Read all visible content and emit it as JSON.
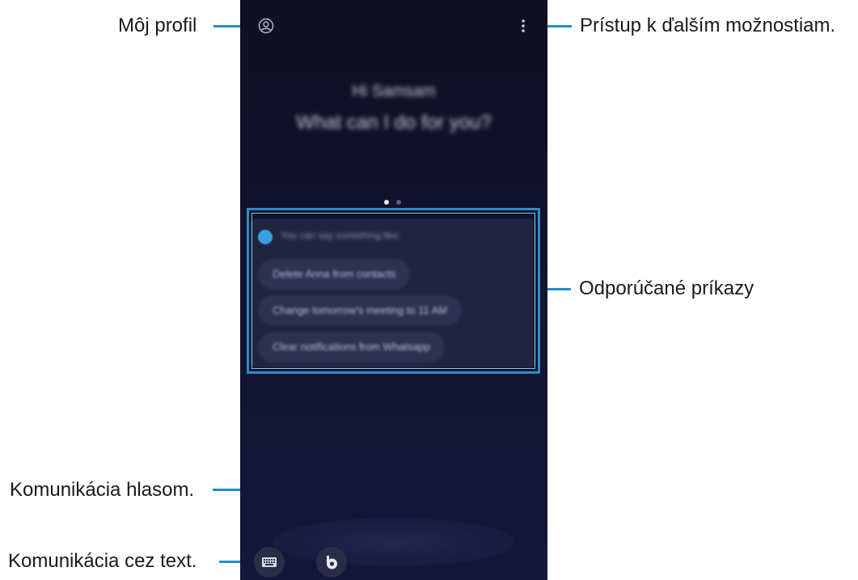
{
  "callouts": {
    "my_profile": "Môj profil",
    "more_options": "Prístup k ďalším možnostiam.",
    "suggested_commands": "Odporúčané príkazy",
    "voice": "Komunikácia hlasom.",
    "text": "Komunikácia cez text."
  },
  "screen": {
    "greeting_line1": "Hi Samsam",
    "greeting_line2": "What can I do for you?",
    "page_indicator": {
      "count": 2,
      "active": 1
    },
    "suggestions_header": "You can say something like:",
    "suggestions": [
      "Delete Anna from contacts",
      "Change tomorrow's meeting to 11 AM",
      "Clear notifications from Whatsapp"
    ]
  },
  "icons": {
    "profile": "profile-icon",
    "more": "more-vertical-icon",
    "keyboard": "keyboard-icon",
    "bixby": "bixby-icon"
  },
  "colors": {
    "accent": "#2a8ec2",
    "screen_bg": "#121431"
  }
}
